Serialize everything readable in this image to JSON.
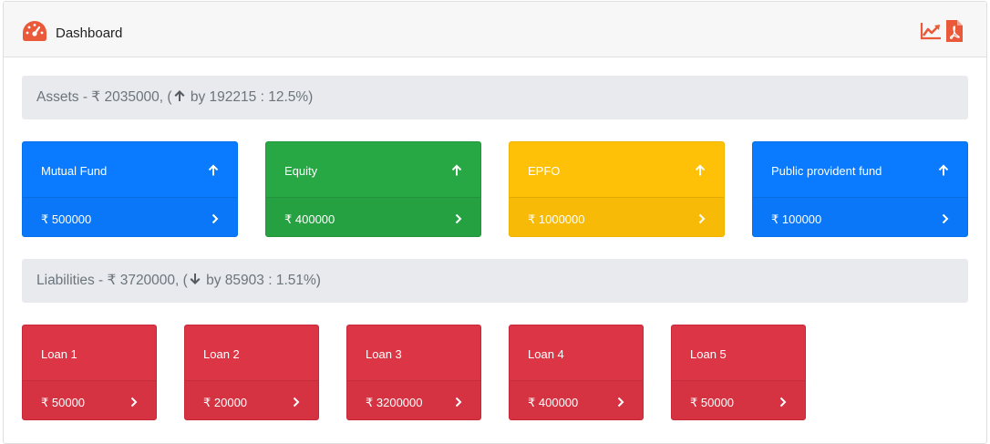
{
  "header": {
    "title": "Dashboard",
    "icon": "dashboard-gauge-icon",
    "actions": [
      {
        "name": "trend-chart-icon"
      },
      {
        "name": "pdf-export-icon"
      }
    ],
    "accent_color": "#e9593a"
  },
  "assets": {
    "summary_prefix": "Assets - ₹ 2035000, (",
    "summary_suffix": " by 192215 : 12.5%)",
    "direction": "up",
    "cards": [
      {
        "label": "Mutual Fund",
        "value": "₹ 500000",
        "color": "#0a7bff"
      },
      {
        "label": "Equity",
        "value": "₹ 400000",
        "color": "#28a745"
      },
      {
        "label": "EPFO",
        "value": "₹ 1000000",
        "color": "#ffc107"
      },
      {
        "label": "Public provident fund",
        "value": "₹ 100000",
        "color": "#0a7bff"
      }
    ]
  },
  "liabilities": {
    "summary_prefix": "Liabilities - ₹ 3720000, (",
    "summary_suffix": " by 85903 : 1.51%)",
    "direction": "down",
    "cards": [
      {
        "label": "Loan 1",
        "value": "₹ 50000",
        "color": "#dc3545"
      },
      {
        "label": "Loan 2",
        "value": "₹ 20000",
        "color": "#dc3545"
      },
      {
        "label": "Loan 3",
        "value": "₹ 3200000",
        "color": "#dc3545"
      },
      {
        "label": "Loan 4",
        "value": "₹ 400000",
        "color": "#dc3545"
      },
      {
        "label": "Loan 5",
        "value": "₹ 50000",
        "color": "#dc3545"
      }
    ]
  }
}
